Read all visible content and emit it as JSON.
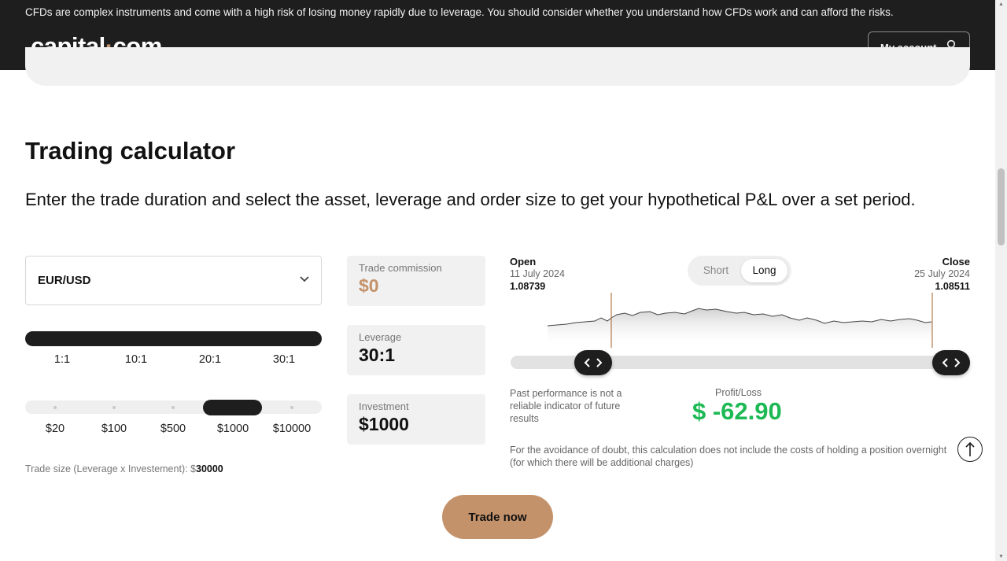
{
  "header": {
    "risk_warning": "CFDs are complex instruments and come with a high risk of losing money rapidly due to leverage. You should consider whether you understand how CFDs work and can afford the risks.",
    "logo": {
      "part1": "capital",
      "dot": "·",
      "part2": "com"
    },
    "account_label": "My account"
  },
  "calculator": {
    "title": "Trading calculator",
    "intro": "Enter the trade duration and select the asset, leverage and order size to get your hypothetical P&L over a set period.",
    "asset": {
      "selected": "EUR/USD"
    },
    "leverage_options": [
      "1:1",
      "10:1",
      "20:1",
      "30:1"
    ],
    "leverage_selected": "30:1",
    "investment_options": [
      "$20",
      "$100",
      "$500",
      "$1000",
      "$10000"
    ],
    "investment_selected": "$1000",
    "trade_size": {
      "label": "Trade size (Leverage x Investement): $",
      "value": "30000"
    },
    "boxes": {
      "commission": {
        "label": "Trade commission",
        "value": "$0"
      },
      "leverage": {
        "label": "Leverage",
        "value": "30:1"
      },
      "investment": {
        "label": "Investment",
        "value": "$1000"
      }
    },
    "chart": {
      "open": {
        "label": "Open",
        "date": "11 July 2024",
        "value": "1.08739"
      },
      "close": {
        "label": "Close",
        "date": "25 July 2024",
        "value": "1.08511"
      },
      "toggle": {
        "short": "Short",
        "long": "Long",
        "selected": "Long"
      }
    },
    "disclaimer": "Past performance is not a reliable indicator of future results",
    "profit_loss": {
      "label": "Profit/Loss",
      "value": "$ -62.90"
    },
    "footnote": "For the avoidance of doubt, this calculation does not include the costs of holding a position overnight (for which there will be additional charges)",
    "cta": "Trade now"
  },
  "colors": {
    "dark": "#1e1e1e",
    "accent_copper": "#c4926a",
    "profit_green": "#1db954",
    "panel_grey": "#f1f1f1"
  },
  "icons": {
    "account": "user-icon",
    "select": "chevron-down-icon",
    "range_handles": "left-right-arrows-icon",
    "back_to_top": "arrow-up-icon"
  }
}
